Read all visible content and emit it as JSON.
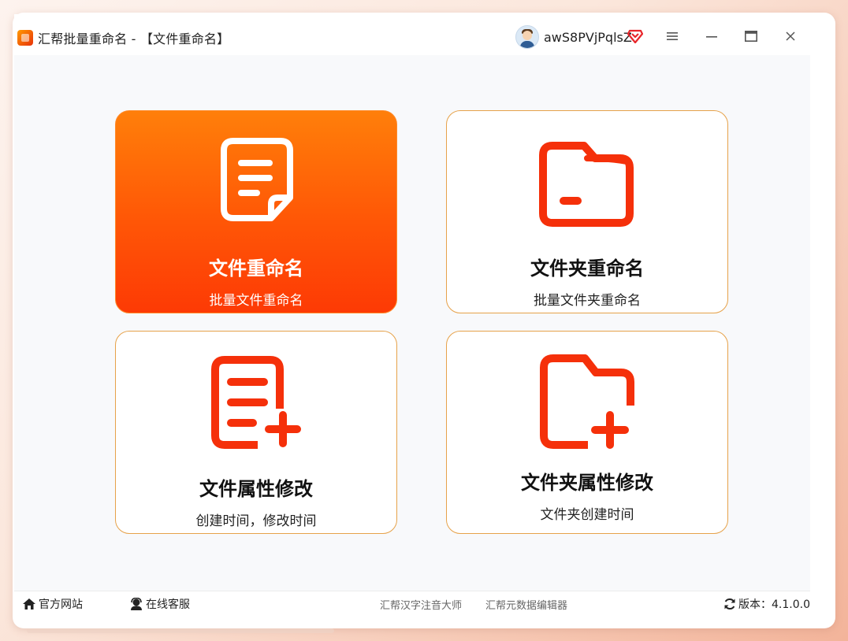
{
  "window": {
    "title": "汇帮批量重命名 - 【文件重命名】",
    "username": "awS8PVjPqlsZ",
    "icons": {
      "app": "app-logo-icon",
      "avatar": "user-avatar",
      "vip": "vip-diamond-icon",
      "menu": "menu-icon",
      "minimize": "minimize-icon",
      "maximize": "maximize-icon",
      "close": "close-icon"
    },
    "colors": {
      "vip": "#e8262b",
      "accent": "#ff5606"
    }
  },
  "cards": [
    {
      "title": "文件重命名",
      "subtitle": "批量文件重命名",
      "icon": "document-icon",
      "active": true
    },
    {
      "title": "文件夹重命名",
      "subtitle": "批量文件夹重命名",
      "icon": "folder-icon",
      "active": false
    },
    {
      "title": "文件属性修改",
      "subtitle": "创建时间，修改时间",
      "icon": "document-add-icon",
      "active": false
    },
    {
      "title": "文件夹属性修改",
      "subtitle": "文件夹创建时间",
      "icon": "folder-add-icon",
      "active": false
    }
  ],
  "footer": {
    "website": "官方网站",
    "support": "在线客服",
    "link1": "汇帮汉字注音大师",
    "link2": "汇帮元数据编辑器",
    "version": "版本：4.1.0.0",
    "icons": {
      "website": "home-icon",
      "support": "headset-icon",
      "version": "refresh-icon"
    }
  },
  "colors": {
    "icon_red": "#f5300a",
    "card_border": "#e6a24a"
  }
}
